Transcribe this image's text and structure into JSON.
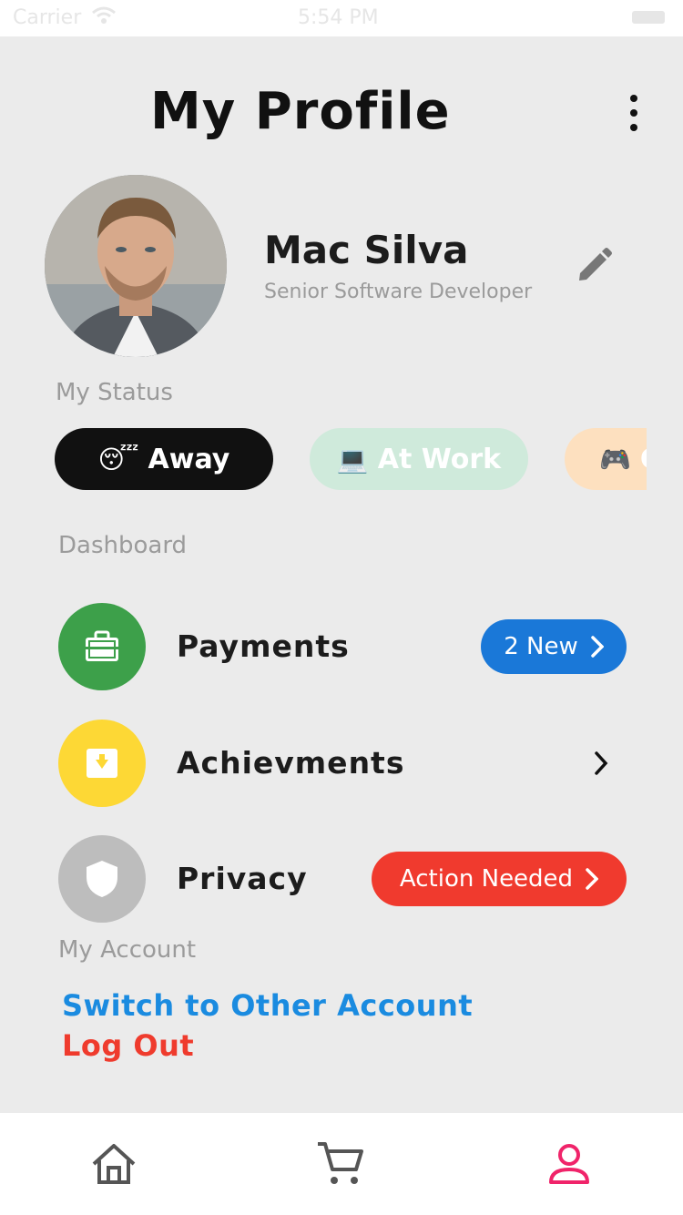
{
  "status_bar": {
    "carrier": "Carrier",
    "time": "5:54 PM"
  },
  "header": {
    "title": "My Profile"
  },
  "profile": {
    "name": "Mac Silva",
    "role": "Senior Software Developer"
  },
  "status": {
    "label": "My Status",
    "chips": [
      {
        "emoji": "😴",
        "label": "Away",
        "color": "#111111"
      },
      {
        "emoji": "💻",
        "label": "At Work",
        "color": "#cfeadb"
      },
      {
        "emoji": "🎮",
        "label": "G",
        "color": "#fde0bf"
      }
    ]
  },
  "dashboard": {
    "label": "Dashboard",
    "items": [
      {
        "label": "Payments",
        "icon": "briefcase-icon",
        "icon_color": "#3da04a",
        "badge": "2 New",
        "badge_color": "#1a78d8"
      },
      {
        "label": "Achievments",
        "icon": "archive-icon",
        "icon_color": "#fdd835"
      },
      {
        "label": "Privacy",
        "icon": "shield-icon",
        "icon_color": "#bdbdbd",
        "badge": "Action Needed",
        "badge_color": "#f03a2e"
      }
    ]
  },
  "account": {
    "label": "My Account",
    "switch_label": "Switch to Other Account",
    "switch_color": "#1a8be0",
    "logout_label": "Log Out",
    "logout_color": "#ef3b2d"
  },
  "tabbar": {
    "tabs": [
      {
        "icon": "home-icon",
        "active": false
      },
      {
        "icon": "cart-icon",
        "active": false
      },
      {
        "icon": "user-icon",
        "active": true
      }
    ],
    "active_color": "#f0246a",
    "inactive_color": "#555555"
  }
}
